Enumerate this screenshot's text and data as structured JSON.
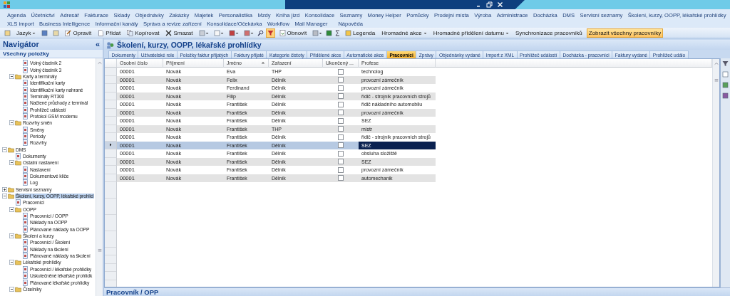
{
  "menu_rows": [
    [
      "Agenda",
      "Účetnictví",
      "Adresář",
      "Fakturace",
      "Sklady",
      "Objednávky",
      "Zakázky",
      "Majetek",
      "Personalistika",
      "Mzdy",
      "Kniha jízd",
      "Konsolidace",
      "Seznamy",
      "Money Helper",
      "Pomůcky",
      "Prodejní místa",
      "Výroba",
      "Administrace",
      "Docházka",
      "DMS",
      "Servisní seznamy",
      "Školení, kurzy, OOPP, lékařské prohlídky"
    ],
    [
      "XLS import",
      "Business Intelligence",
      "Informační kanály",
      "Správa a revize zařízení",
      "Konsolidace/Očekávka",
      "Workflow",
      "Mail Manager",
      "Nápověda"
    ]
  ],
  "toolbar": {
    "filter_on": true,
    "items": [
      {
        "label": "Jazyk",
        "kind": "dropdown",
        "on": false
      },
      {
        "label": "Opravit",
        "kind": "button",
        "on": false
      },
      {
        "label": "Přidat",
        "kind": "button",
        "on": false
      },
      {
        "label": "Kopírovat",
        "kind": "button",
        "on": false
      },
      {
        "label": "Smazat",
        "kind": "button",
        "on": false
      },
      {
        "label": "Obnovit",
        "kind": "button",
        "on": false
      },
      {
        "label": "Legenda",
        "kind": "button",
        "on": false
      },
      {
        "label": "Hromadné akce",
        "kind": "dropdown",
        "on": false
      },
      {
        "label": "Hromadné přidělení datumu",
        "kind": "dropdown",
        "on": false
      },
      {
        "label": "Synchronizace pracovníků",
        "kind": "button",
        "on": false
      },
      {
        "label": "Zobrazit všechny pracovníky",
        "kind": "button",
        "on": true
      }
    ]
  },
  "navigator": {
    "title": "Navigátor",
    "collapse": "«",
    "section": "Všechny položky",
    "tree_partial_leaves": [
      {
        "label": "Volný číselník 2",
        "selected": false
      },
      {
        "label": "Volný číselník 3",
        "selected": false
      }
    ],
    "tree_partial_nodes": [
      {
        "label": "Karty a terminály",
        "expanded": true,
        "selected": false,
        "children": [
          {
            "label": "Identifikační karty",
            "selected": false
          },
          {
            "label": "Identifikační karty nahrané",
            "selected": false
          },
          {
            "label": "Terminály RT300",
            "selected": false
          },
          {
            "label": "Načtené průchody z terminál",
            "selected": false
          },
          {
            "label": "Prohlížeč událostí",
            "selected": false
          },
          {
            "label": "Protokol GSM modemu",
            "selected": false
          }
        ]
      },
      {
        "label": "Rozvrhy směn",
        "expanded": true,
        "selected": false,
        "children": [
          {
            "label": "Směny",
            "selected": false
          },
          {
            "label": "Periody",
            "selected": false
          },
          {
            "label": "Rozvrhy",
            "selected": false
          }
        ]
      }
    ],
    "tree": [
      {
        "label": "DMS",
        "expanded": true,
        "selected": false,
        "children": [
          {
            "label": "Dokumenty",
            "selected": false
          },
          {
            "label": "Ostatní nastavení",
            "expanded": true,
            "selected": false,
            "children": [
              {
                "label": "Nastavení",
                "selected": false
              },
              {
                "label": "Dokumentové klíče",
                "selected": false
              },
              {
                "label": "Log",
                "selected": false
              }
            ]
          }
        ]
      },
      {
        "label": "Servisní seznamy",
        "expanded": false,
        "selected": false
      },
      {
        "label": "Školení, kurzy, OOPP, lékařské prohlíd",
        "expanded": true,
        "selected": true,
        "children": [
          {
            "label": "Pracovníci",
            "selected": false
          },
          {
            "label": "OOPP",
            "expanded": true,
            "selected": false,
            "children": [
              {
                "label": "Pracovníci / OOPP",
                "selected": false
              },
              {
                "label": "Náklady na OOPP",
                "selected": false
              },
              {
                "label": "Plánované náklady na OOPP",
                "selected": false
              }
            ]
          },
          {
            "label": "Školení a kurzy",
            "expanded": true,
            "selected": false,
            "children": [
              {
                "label": "Pracovníci / Školení",
                "selected": false
              },
              {
                "label": "Náklady na školení",
                "selected": false
              },
              {
                "label": "Plánované náklady na školení",
                "selected": false
              }
            ]
          },
          {
            "label": "Lékařské prohlídky",
            "expanded": true,
            "selected": false,
            "children": [
              {
                "label": "Pracovníci / lékařské prohlídky",
                "selected": false
              },
              {
                "label": "Uskutečněné lékařské prohlídk",
                "selected": false
              },
              {
                "label": "Plánované lékařské prohlídky",
                "selected": false
              }
            ]
          },
          {
            "label": "Číselníky",
            "expanded": true,
            "selected": false
          }
        ]
      }
    ]
  },
  "module_title": "Školení, kurzy, OOPP, lékařské prohlídky",
  "tabs": [
    {
      "label": "Dokumenty",
      "selected": false
    },
    {
      "label": "Uživatelské role",
      "selected": false
    },
    {
      "label": "Položky faktur přijatých",
      "selected": false
    },
    {
      "label": "Faktury přijaté",
      "selected": false
    },
    {
      "label": "Kategorie čistoty",
      "selected": false
    },
    {
      "label": "Přidělené akce",
      "selected": false
    },
    {
      "label": "Automatické akce",
      "selected": false
    },
    {
      "label": "Pracovníci",
      "selected": true
    },
    {
      "label": "Zprávy",
      "selected": false
    },
    {
      "label": "Objednávky vydané",
      "selected": false
    },
    {
      "label": "Import z XML",
      "selected": false
    },
    {
      "label": "Prohlížeč událostí",
      "selected": false
    },
    {
      "label": "Docházka - pracovníci",
      "selected": false
    },
    {
      "label": "Faktury vydané",
      "selected": false
    },
    {
      "label": "Prohlížeč událo",
      "selected": false
    }
  ],
  "table": {
    "columns": [
      {
        "label": "Osobní číslo",
        "sorted": false
      },
      {
        "label": "Příjmení",
        "sorted": false
      },
      {
        "label": "Jméno",
        "sorted": true
      },
      {
        "label": "Zařazení",
        "sorted": false
      },
      {
        "label": "Ukončený ...",
        "sorted": false
      },
      {
        "label": "Profese",
        "sorted": false
      }
    ],
    "rows": [
      {
        "number": "00001",
        "surname": "Novák",
        "name": "Eva",
        "position": "THP",
        "ended": false,
        "profession": "technolog",
        "selected": false
      },
      {
        "number": "00001",
        "surname": "Novák",
        "name": "Felix",
        "position": "Dělník",
        "ended": false,
        "profession": "provozní zámečník",
        "selected": false
      },
      {
        "number": "00001",
        "surname": "Novák",
        "name": "Ferdinand",
        "position": "Dělník",
        "ended": false,
        "profession": "provozní zámečník",
        "selected": false
      },
      {
        "number": "00001",
        "surname": "Novák",
        "name": "Filip",
        "position": "Dělník",
        "ended": false,
        "profession": "řidič - strojník pracovních strojů",
        "selected": false
      },
      {
        "number": "00001",
        "surname": "Novák",
        "name": "František",
        "position": "Dělník",
        "ended": false,
        "profession": "řidič nákladního automobilu",
        "selected": false
      },
      {
        "number": "00001",
        "surname": "Novák",
        "name": "František",
        "position": "Dělník",
        "ended": false,
        "profession": "provozní zámečník",
        "selected": false
      },
      {
        "number": "00001",
        "surname": "Novák",
        "name": "František",
        "position": "Dělník",
        "ended": false,
        "profession": "SEZ",
        "selected": false
      },
      {
        "number": "00001",
        "surname": "Novák",
        "name": "František",
        "position": "THP",
        "ended": false,
        "profession": "mistr",
        "selected": false
      },
      {
        "number": "00001",
        "surname": "Novák",
        "name": "František",
        "position": "Dělník",
        "ended": false,
        "profession": "řidič - strojník pracovních strojů",
        "selected": false
      },
      {
        "number": "00001",
        "surname": "Novák",
        "name": "František",
        "position": "Dělník",
        "ended": false,
        "profession": "SEZ",
        "selected": true
      },
      {
        "number": "00001",
        "surname": "Novák",
        "name": "František",
        "position": "Dělník",
        "ended": false,
        "profession": "obsluha složiště",
        "selected": false
      },
      {
        "number": "00001",
        "surname": "Novák",
        "name": "František",
        "position": "Dělník",
        "ended": false,
        "profession": "SEZ",
        "selected": false
      },
      {
        "number": "00001",
        "surname": "Novák",
        "name": "František",
        "position": "Dělník",
        "ended": false,
        "profession": "provozní zámečník",
        "selected": false
      },
      {
        "number": "00001",
        "surname": "Novák",
        "name": "František",
        "position": "Dělník",
        "ended": false,
        "profession": "automechanik",
        "selected": false
      }
    ]
  },
  "bottom_panel": {
    "title": "Pracovník / OPP"
  }
}
